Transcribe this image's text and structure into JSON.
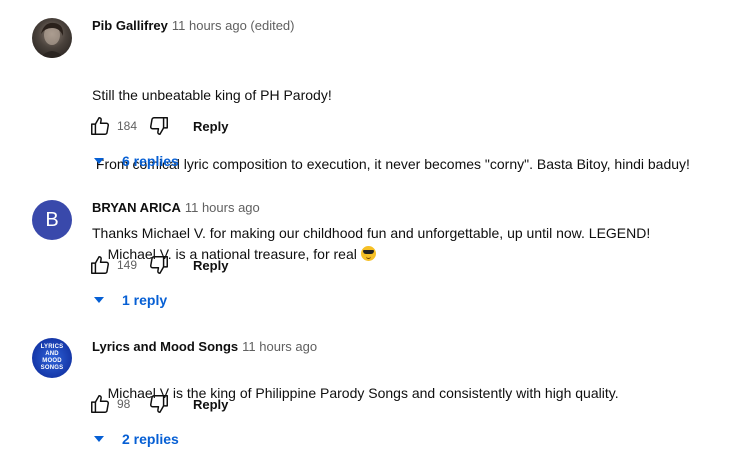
{
  "comments": [
    {
      "author": "Pib Gallifrey",
      "time": "11 hours ago (edited)",
      "lines": [
        "Still the unbeatable king of PH Parody!",
        " From comical lyric composition to execution, it never becomes \"corny\". Basta Bitoy, hindi baduy!",
        "Thanks Michael V. for making our childhood fun and unforgettable, up until now. LEGEND!"
      ],
      "likes": "184",
      "reply_label": "Reply",
      "replies_label": "6 replies"
    },
    {
      "author": "BRYAN ARICA",
      "avatar_letter": "B",
      "time": "11 hours ago",
      "lines": [
        "Michael V. is a national treasure, for real "
      ],
      "emoji": "smiling-face-with-sunglasses",
      "likes": "149",
      "reply_label": "Reply",
      "replies_label": "1 reply"
    },
    {
      "author": "Lyrics and Mood Songs",
      "avatar_logo": [
        "LYRICS",
        "AND",
        "MOOD",
        "SONGS"
      ],
      "time": "11 hours ago",
      "lines": [
        "Michael V is the king of Philippine Parody Songs and consistently with high quality."
      ],
      "likes": "98",
      "reply_label": "Reply",
      "replies_label": "2 replies"
    }
  ],
  "icons": {
    "like": "thumbs-up-icon",
    "dislike": "thumbs-down-icon",
    "expand": "caret-down-icon"
  },
  "colors": {
    "link_blue": "#065fd4",
    "avatar_b": "#3949ab"
  }
}
